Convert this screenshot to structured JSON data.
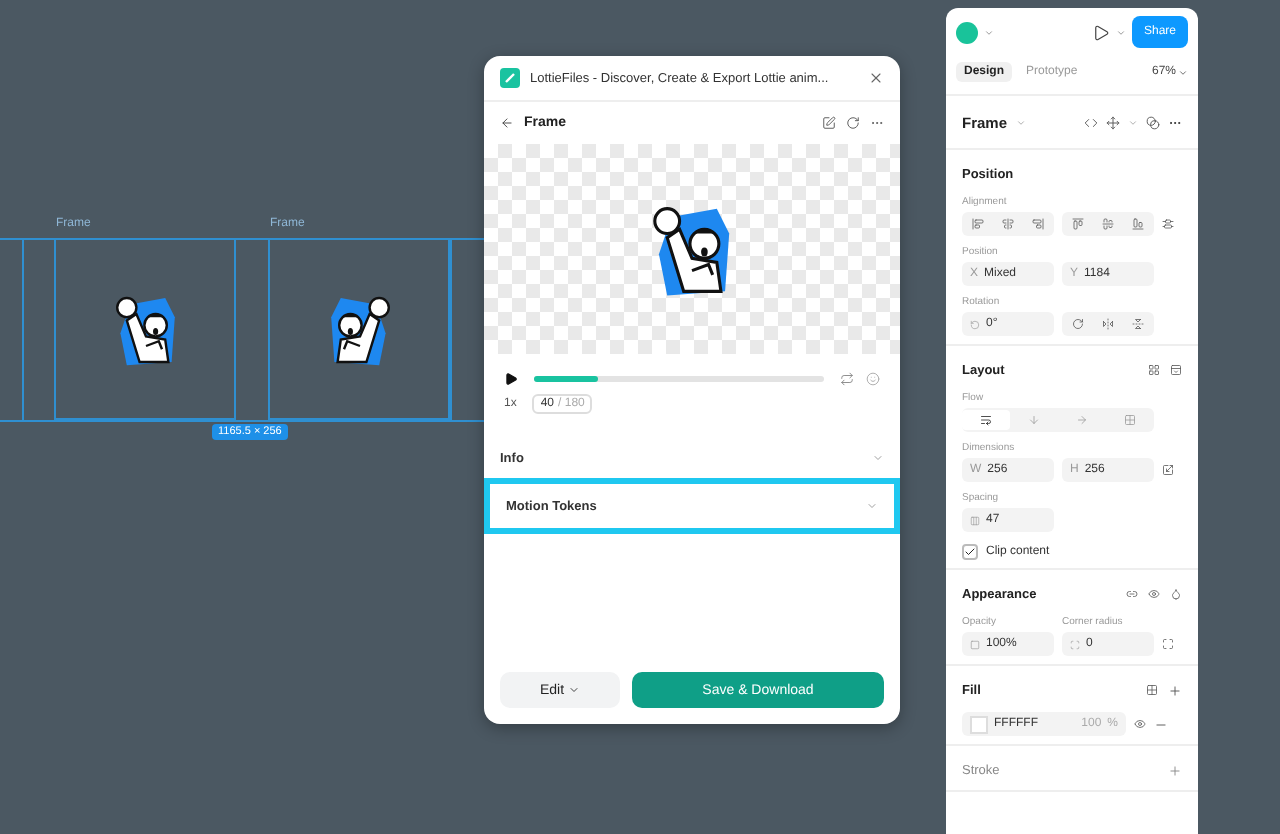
{
  "canvas": {
    "frames": [
      {
        "label": "Frame"
      },
      {
        "label": "Frame"
      }
    ],
    "size_badge": "1165.5 × 256"
  },
  "plugin": {
    "title": "LottieFiles - Discover, Create & Export Lottie anim...",
    "heading": "Frame",
    "player": {
      "playing": false,
      "level": 0.22,
      "speed": "1x",
      "frame": "40",
      "total": "/ 180"
    },
    "sections": [
      {
        "label": "Info",
        "highlighted": false
      },
      {
        "label": "Motion Tokens",
        "highlighted": true
      }
    ],
    "edit_button": "Edit",
    "save_button": "Save & Download"
  },
  "panel": {
    "share_button": "Share",
    "tabs": [
      {
        "label": "Design",
        "selected": true
      },
      {
        "label": "Prototype",
        "selected": false
      }
    ],
    "zoom": "67%",
    "layer": "Frame",
    "position": {
      "title": "Position",
      "alignment_label": "Alignment",
      "position_label": "Position",
      "x": {
        "prefix": "X",
        "value": "Mixed"
      },
      "y": {
        "prefix": "Y",
        "value": "1184"
      },
      "rotation_label": "Rotation",
      "rotation": "0°"
    },
    "layout": {
      "title": "Layout",
      "flow_label": "Flow",
      "flow": [
        {
          "selected": true
        },
        {
          "selected": false
        },
        {
          "selected": false
        },
        {
          "selected": false
        }
      ],
      "dimensions_label": "Dimensions",
      "w": {
        "prefix": "W",
        "value": "256"
      },
      "h": {
        "prefix": "H",
        "value": "256"
      },
      "spacing_label": "Spacing",
      "spacing": "47",
      "clip": {
        "label": "Clip content",
        "checked": true
      }
    },
    "appearance": {
      "title": "Appearance",
      "opacity_label": "Opacity",
      "opacity": "100%",
      "radius_label": "Corner radius",
      "radius": "0"
    },
    "fill": {
      "title": "Fill",
      "hex": "FFFFFF",
      "opacity": "100",
      "unit": "%"
    },
    "stroke": {
      "title": "Stroke"
    }
  }
}
